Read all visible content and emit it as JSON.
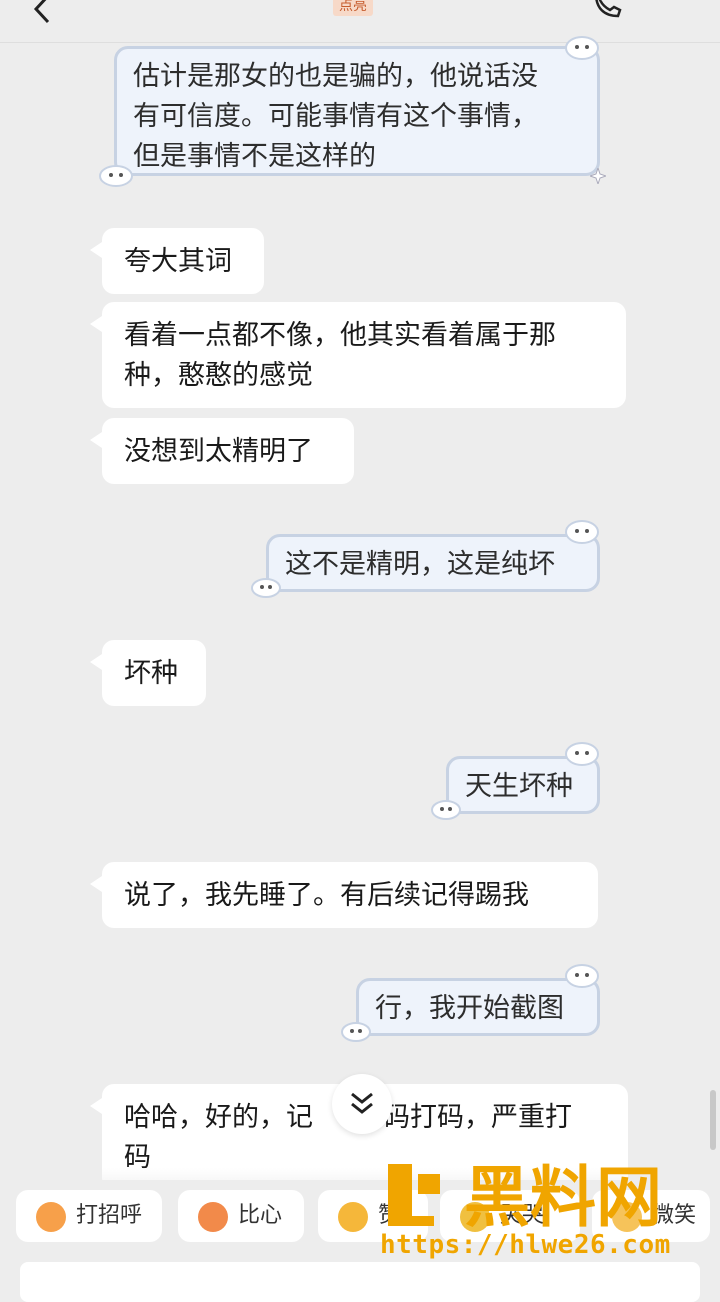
{
  "header": {
    "title_tag": "点亮",
    "back_icon": "chevron-left-icon",
    "call_icon": "phone-icon"
  },
  "messages": [
    {
      "side": "right",
      "lines": [
        "估计是那女的也是骗的，他说话没",
        "有可信度。可能事情有这个事情，",
        "但是事情不是这样的"
      ]
    },
    {
      "side": "left",
      "lines": [
        "夸大其词"
      ]
    },
    {
      "side": "left",
      "lines": [
        "看着一点都不像，他其实看着属于那",
        "种，憨憨的感觉"
      ]
    },
    {
      "side": "left",
      "lines": [
        "没想到太精明了"
      ]
    },
    {
      "side": "right",
      "lines": [
        "这不是精明，这是纯坏"
      ]
    },
    {
      "side": "left",
      "lines": [
        "坏种"
      ]
    },
    {
      "side": "right",
      "lines": [
        "天生坏种"
      ]
    },
    {
      "side": "left",
      "lines": [
        "说了，我先睡了。有后续记得踢我"
      ]
    },
    {
      "side": "right",
      "lines": [
        "行，我开始截图"
      ]
    },
    {
      "side": "left",
      "lines": [
        "哈哈，好的，记",
        "码打码，严重打",
        "码"
      ]
    }
  ],
  "quick_replies": [
    {
      "label": "打招呼",
      "icon": "smile-wave-icon"
    },
    {
      "label": "比心",
      "icon": "heart-hands-icon"
    },
    {
      "label": "赞",
      "icon": "thumbs-up-icon"
    },
    {
      "label": "哭哭",
      "icon": "crying-icon"
    },
    {
      "label": "微笑",
      "icon": "smile-icon"
    }
  ],
  "watermark": {
    "logo_text": "黑料网",
    "url": "https://hlwe26.com"
  },
  "colors": {
    "background": "#ededed",
    "left_bubble": "#ffffff",
    "right_bubble": "#eef3fb",
    "right_border": "#c7d2e3",
    "watermark_orange": "#f0a500"
  }
}
